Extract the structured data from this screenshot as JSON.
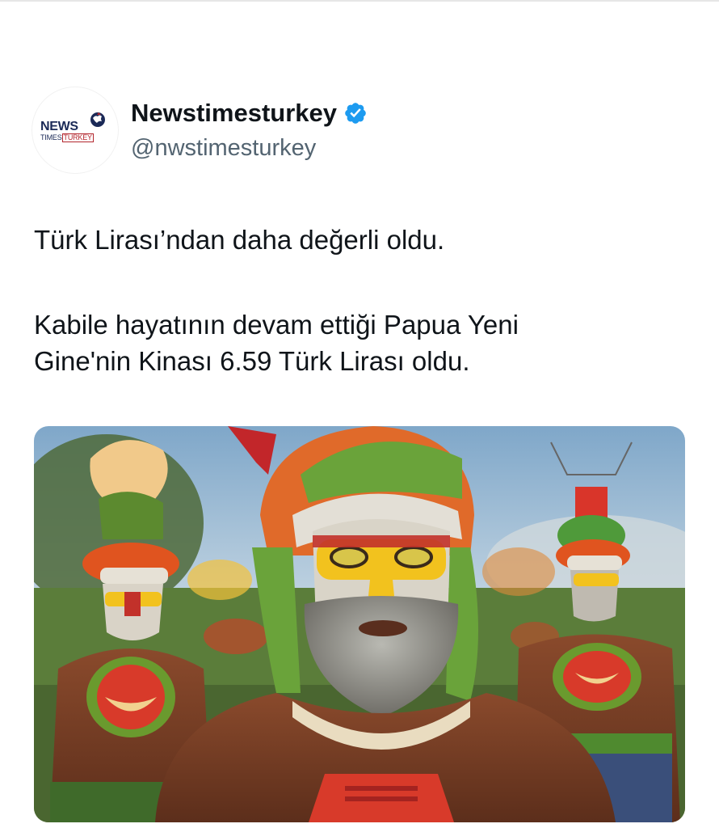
{
  "account": {
    "display_name": "Newstimesturkey",
    "handle": "@nwstimesturkey",
    "verified": true,
    "verified_icon": "verified-badge-icon",
    "avatar": {
      "logo_word": "NEWS",
      "logo_sub_left": "TIMES",
      "logo_sub_right": "TURKEY"
    }
  },
  "tweet": {
    "text_line_1": "Türk Lirası’ndan daha değerli oldu.",
    "text_line_2": "Kabile hayatının devam ettiği Papua Yeni",
    "text_line_3": "Gine'nin Kinası 6.59 Türk Lirası oldu."
  },
  "colors": {
    "text_primary": "#0f1419",
    "text_secondary": "#536471",
    "verified_blue": "#1d9bf0"
  }
}
